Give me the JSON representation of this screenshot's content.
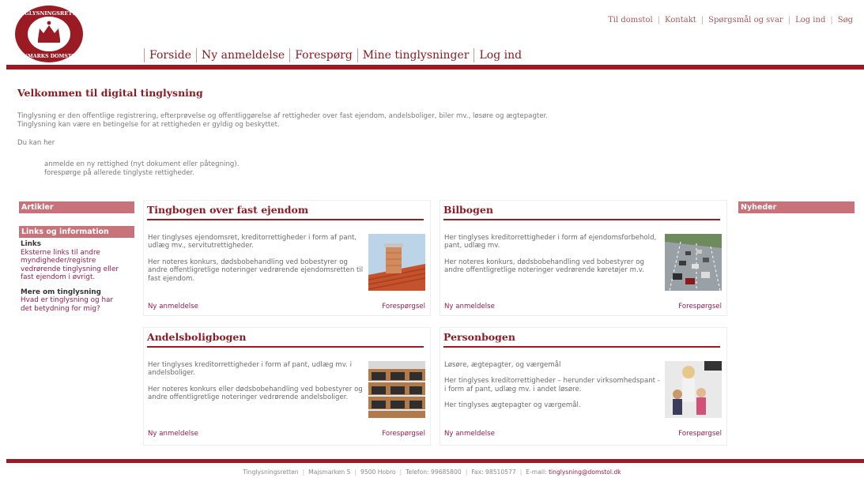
{
  "logo": {
    "top_text": "TINGLYSNINGSRETTEN",
    "bottom_text": "DANMARKS DOMSTOLE",
    "icon": "crown-icon"
  },
  "top_links": [
    "Til domstol",
    "Kontakt",
    "Spørgsmål og svar",
    "Log ind",
    "Søg"
  ],
  "main_nav": [
    "Forside",
    "Ny anmeldelse",
    "Forespørg",
    "Mine tinglysninger",
    "Log ind"
  ],
  "intro": {
    "title": "Velkommen til digital tinglysning",
    "p1": "Tinglysning er den offentlige registrering, efterprøvelse og offentliggørelse af rettigheder over fast ejendom, andelsboliger, biler mv., løsøre og ægtepagter.",
    "p2": "Tinglysning kan være en betingelse for at rettigheden er gyldig og beskyttet.",
    "du_kan": "Du kan her",
    "bullet1": "anmelde en ny rettighed (nyt dokument eller påtegning).",
    "bullet2": "forespørge på allerede tinglyste rettigheder."
  },
  "left": {
    "artikler": "Artikler",
    "links_heading": "Links og information",
    "links_label": "Links",
    "links_text": [
      "Eksterne links til andre",
      "myndigheder/registre",
      "vedrørende tinglysning eller",
      "fast ejendom i øvrigt."
    ],
    "mere_label": "Mere om tinglysning",
    "mere_text": [
      "Hvad er tinglysning og har",
      "det betydning for mig?"
    ]
  },
  "right": {
    "nyheder": "Nyheder"
  },
  "boxes": {
    "tingbogen": {
      "title": "Tingbogen over fast ejendom",
      "p1": "Her tinglyses ejendomsret, kreditorrettigheder i form af pant, udlæg mv., servitutrettigheder.",
      "p2": "Her noteres konkurs, dødsbobehandling ved bobestyrer og andre offentligretlige noteringer vedrørende ejendomsretten til fast ejendom.",
      "ny": "Ny anmeldelse",
      "fo": "Forespørgsel"
    },
    "bilbogen": {
      "title": "Bilbogen",
      "p1": "Her tinglyses kreditorrettigheder i form af ejendomsforbehold, pant, udlæg mv.",
      "p2": "Her noteres konkurs, dødsbobehandling ved bobestyrer og andre offentligretlige noteringer vedrørende køretøjer m.v.",
      "ny": "Ny anmeldelse",
      "fo": "Forespørgsel"
    },
    "andels": {
      "title": "Andelsboligbogen",
      "p1": "Her tinglyses kreditorrettigheder i form af pant, udlæg mv. i andelsboliger.",
      "p2": "Her noteres konkurs eller dødsbobehandling ved bobestyrer og andre offentligretlige noteringer vedrørende andelsboliger.",
      "ny": "Ny anmeldelse",
      "fo": "Forespørgsel"
    },
    "person": {
      "title": "Personbogen",
      "p1": "Løsøre, ægtepagter, og værgemål",
      "p2": "Her tinglyses kreditorrettigheder – herunder virksomhedspant - i form af pant, udlæg mv. i andet løsøre.",
      "p3": "Her tinglyses ægtepagter og værgemål.",
      "ny": "Ny anmeldelse",
      "fo": "Forespørgsel"
    }
  },
  "footer": {
    "org": "Tinglysningsretten",
    "address": "Majsmarken 5",
    "city": "9500 Hobro",
    "phone": "Telefon: 99685800",
    "fax": "Fax: 98510577",
    "email_label": "E-mail:",
    "email": "tinglysning@domstol.dk"
  },
  "colors": {
    "brand": "#9b1b24",
    "side_head": "#c8737a",
    "link": "#9b1b4b"
  }
}
